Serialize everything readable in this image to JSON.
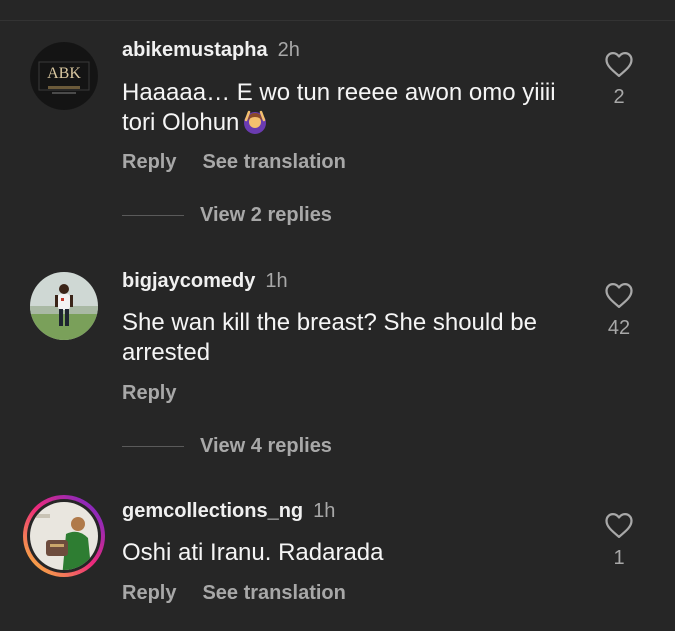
{
  "comments": [
    {
      "username": "abikemustapha",
      "time": "2h",
      "text": "Haaaaa… E wo tun reeee awon omo yiiii tori Olohun",
      "emoji": "woman-raising-hands-emoji",
      "reply_label": "Reply",
      "translate_label": "See translation",
      "like_count": "2",
      "replies_label": "View 2 replies",
      "avatar": "abk-logo-avatar",
      "avatar_text": "ABK"
    },
    {
      "username": "bigjaycomedy",
      "time": "1h",
      "text": "She wan kill the breast? She should be arrested",
      "reply_label": "Reply",
      "like_count": "42",
      "replies_label": "View 4 replies",
      "avatar": "person-photo-avatar"
    },
    {
      "username": "gemcollections_ng",
      "time": "1h",
      "text": "Oshi ati Iranu. Radarada",
      "reply_label": "Reply",
      "translate_label": "See translation",
      "like_count": "1",
      "avatar": "story-ring-avatar"
    }
  ],
  "colors": {
    "background": "#262626",
    "secondary_text": "#a8a8a8",
    "primary_text": "#f5f5f5",
    "story_ring_start": "#f9ce34",
    "story_ring_mid": "#ee2a7b",
    "story_ring_end": "#6228d7"
  }
}
